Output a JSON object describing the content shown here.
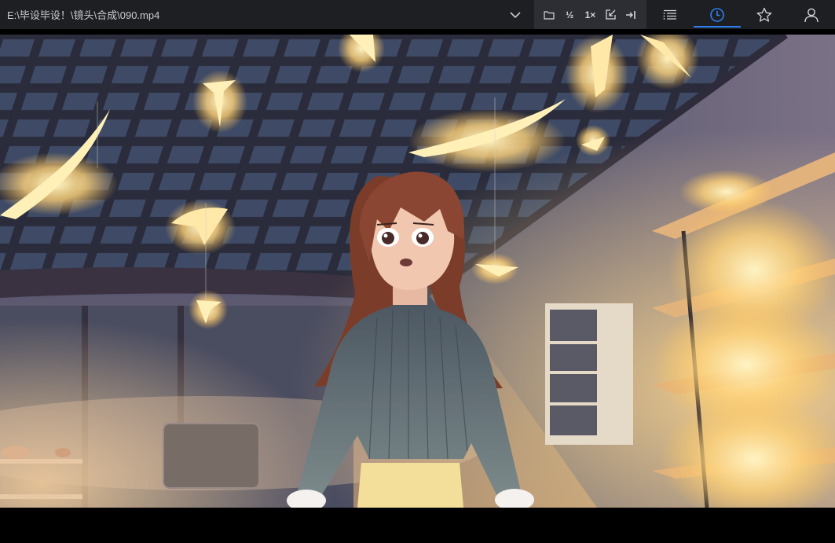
{
  "titlebar": {
    "file_path": "E:\\毕设毕设！\\镜头\\合成\\090.mp4"
  },
  "toolbar": {
    "half_speed_label": "½",
    "speed_label": "1×"
  },
  "icons": {
    "dropdown": "chevron-down-icon",
    "open_folder": "folder-icon",
    "snapshot": "export-icon",
    "pin": "pin-icon",
    "playlist": "playlist-icon",
    "history": "clock-icon",
    "favorites": "star-icon",
    "account": "user-icon"
  },
  "colors": {
    "topbar_bg": "#1e1f22",
    "toolgroup_bg": "#2c2e33",
    "active_accent": "#2f7ff0",
    "icon_color": "#d6d8dc",
    "video_letterbox": "#000000"
  }
}
